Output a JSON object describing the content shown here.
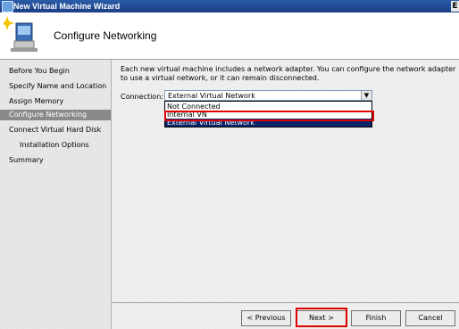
{
  "window": {
    "title": "New Virtual Machine Wizard",
    "corner_glyph": "E"
  },
  "header": {
    "title": "Configure Networking",
    "icon": "computer-network-wizard-icon"
  },
  "nav": {
    "items": [
      {
        "label": "Before You Begin",
        "active": false,
        "sub": false
      },
      {
        "label": "Specify Name and Location",
        "active": false,
        "sub": false
      },
      {
        "label": "Assign Memory",
        "active": false,
        "sub": false
      },
      {
        "label": "Configure Networking",
        "active": true,
        "sub": false
      },
      {
        "label": "Connect Virtual Hard Disk",
        "active": false,
        "sub": false
      },
      {
        "label": "Installation Options",
        "active": false,
        "sub": true
      },
      {
        "label": "Summary",
        "active": false,
        "sub": false
      }
    ]
  },
  "main": {
    "description": "Each new virtual machine includes a network adapter. You can configure the network adapter to use a virtual network, or it can remain disconnected.",
    "connection_label": "Connection:",
    "connection_value": "External Virtual Network",
    "dropdown_options": [
      "Not Connected",
      "Internal VN",
      "External Virtual Network"
    ],
    "highlighted_option": "External Virtual Network"
  },
  "buttons": {
    "previous": "< Previous",
    "next": "Next >",
    "finish": "Finish",
    "cancel": "Cancel"
  },
  "colors": {
    "annotation_red": "#e00000",
    "selection_blue": "#0a246a",
    "titlebar_blue": "#1c3f86"
  }
}
